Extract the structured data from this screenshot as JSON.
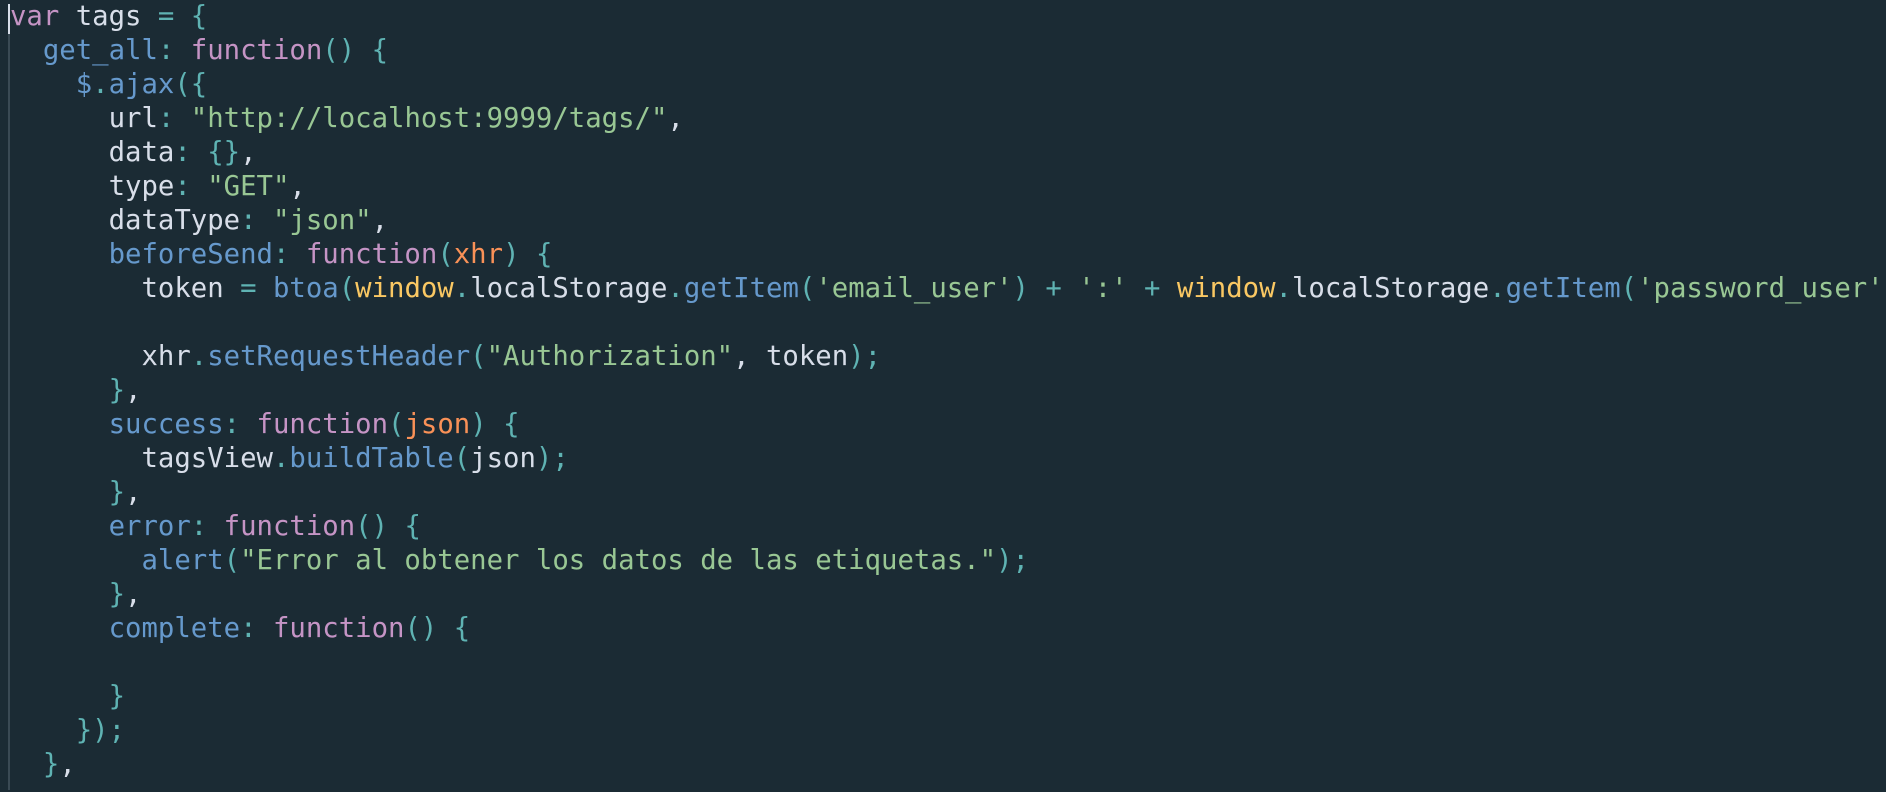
{
  "editor": {
    "language": "javascript",
    "theme_colors": {
      "background": "#1b2b34",
      "keyword": "#c594c5",
      "property": "#6699cc",
      "string": "#99c794",
      "punctuation": "#5fb3b3",
      "parameter": "#f99157",
      "global": "#fac863",
      "identifier": "#d8dee9"
    },
    "lines": [
      [
        [
          "kw",
          "var"
        ],
        [
          "id",
          " tags "
        ],
        [
          "punc",
          "="
        ],
        [
          "id",
          " "
        ],
        [
          "punc",
          "{"
        ]
      ],
      [
        [
          "id",
          "  "
        ],
        [
          "prop",
          "get_all"
        ],
        [
          "punc",
          ":"
        ],
        [
          "id",
          " "
        ],
        [
          "kw",
          "function"
        ],
        [
          "punc",
          "()"
        ],
        [
          "id",
          " "
        ],
        [
          "punc",
          "{"
        ]
      ],
      [
        [
          "id",
          "    "
        ],
        [
          "prop",
          "$"
        ],
        [
          "punc",
          "."
        ],
        [
          "prop",
          "ajax"
        ],
        [
          "punc",
          "({"
        ]
      ],
      [
        [
          "id",
          "      url"
        ],
        [
          "punc",
          ":"
        ],
        [
          "id",
          " "
        ],
        [
          "str",
          "\"http://localhost:9999/tags/\""
        ],
        [
          "id",
          ","
        ]
      ],
      [
        [
          "id",
          "      data"
        ],
        [
          "punc",
          ":"
        ],
        [
          "id",
          " "
        ],
        [
          "punc",
          "{}"
        ],
        [
          "id",
          ","
        ]
      ],
      [
        [
          "id",
          "      type"
        ],
        [
          "punc",
          ":"
        ],
        [
          "id",
          " "
        ],
        [
          "str",
          "\"GET\""
        ],
        [
          "id",
          ","
        ]
      ],
      [
        [
          "id",
          "      dataType"
        ],
        [
          "punc",
          ":"
        ],
        [
          "id",
          " "
        ],
        [
          "str",
          "\"json\""
        ],
        [
          "id",
          ","
        ]
      ],
      [
        [
          "id",
          "      "
        ],
        [
          "prop",
          "beforeSend"
        ],
        [
          "punc",
          ":"
        ],
        [
          "id",
          " "
        ],
        [
          "kw",
          "function"
        ],
        [
          "punc",
          "("
        ],
        [
          "param",
          "xhr"
        ],
        [
          "punc",
          ")"
        ],
        [
          "id",
          " "
        ],
        [
          "punc",
          "{"
        ]
      ],
      [
        [
          "id",
          "        token "
        ],
        [
          "punc",
          "="
        ],
        [
          "id",
          " "
        ],
        [
          "fn",
          "btoa"
        ],
        [
          "punc",
          "("
        ],
        [
          "glob",
          "window"
        ],
        [
          "punc",
          "."
        ],
        [
          "id",
          "localStorage"
        ],
        [
          "punc",
          "."
        ],
        [
          "fn",
          "getItem"
        ],
        [
          "punc",
          "("
        ],
        [
          "str",
          "'email_user'"
        ],
        [
          "punc",
          ")"
        ],
        [
          "id",
          " "
        ],
        [
          "punc",
          "+"
        ],
        [
          "id",
          " "
        ],
        [
          "str",
          "':'"
        ],
        [
          "id",
          " "
        ],
        [
          "punc",
          "+"
        ],
        [
          "id",
          " "
        ],
        [
          "glob",
          "window"
        ],
        [
          "punc",
          "."
        ],
        [
          "id",
          "localStorage"
        ],
        [
          "punc",
          "."
        ],
        [
          "fn",
          "getItem"
        ],
        [
          "punc",
          "("
        ],
        [
          "str",
          "'password_user'"
        ],
        [
          "punc",
          "));"
        ]
      ],
      [
        [
          "id",
          ""
        ]
      ],
      [
        [
          "id",
          "        xhr"
        ],
        [
          "punc",
          "."
        ],
        [
          "fn",
          "setRequestHeader"
        ],
        [
          "punc",
          "("
        ],
        [
          "str",
          "\"Authorization\""
        ],
        [
          "id",
          ", token"
        ],
        [
          "punc",
          ");"
        ]
      ],
      [
        [
          "id",
          "      "
        ],
        [
          "punc",
          "}"
        ],
        [
          "id",
          ","
        ]
      ],
      [
        [
          "id",
          "      "
        ],
        [
          "prop",
          "success"
        ],
        [
          "punc",
          ":"
        ],
        [
          "id",
          " "
        ],
        [
          "kw",
          "function"
        ],
        [
          "punc",
          "("
        ],
        [
          "param",
          "json"
        ],
        [
          "punc",
          ")"
        ],
        [
          "id",
          " "
        ],
        [
          "punc",
          "{"
        ]
      ],
      [
        [
          "id",
          "        tagsView"
        ],
        [
          "punc",
          "."
        ],
        [
          "fn",
          "buildTable"
        ],
        [
          "punc",
          "("
        ],
        [
          "id",
          "json"
        ],
        [
          "punc",
          ");"
        ]
      ],
      [
        [
          "id",
          "      "
        ],
        [
          "punc",
          "}"
        ],
        [
          "id",
          ","
        ]
      ],
      [
        [
          "id",
          "      "
        ],
        [
          "prop",
          "error"
        ],
        [
          "punc",
          ":"
        ],
        [
          "id",
          " "
        ],
        [
          "kw",
          "function"
        ],
        [
          "punc",
          "()"
        ],
        [
          "id",
          " "
        ],
        [
          "punc",
          "{"
        ]
      ],
      [
        [
          "id",
          "        "
        ],
        [
          "fn",
          "alert"
        ],
        [
          "punc",
          "("
        ],
        [
          "str",
          "\"Error al obtener los datos de las etiquetas.\""
        ],
        [
          "punc",
          ");"
        ]
      ],
      [
        [
          "id",
          "      "
        ],
        [
          "punc",
          "}"
        ],
        [
          "id",
          ","
        ]
      ],
      [
        [
          "id",
          "      "
        ],
        [
          "prop",
          "complete"
        ],
        [
          "punc",
          ":"
        ],
        [
          "id",
          " "
        ],
        [
          "kw",
          "function"
        ],
        [
          "punc",
          "()"
        ],
        [
          "id",
          " "
        ],
        [
          "punc",
          "{"
        ]
      ],
      [
        [
          "id",
          ""
        ]
      ],
      [
        [
          "id",
          "      "
        ],
        [
          "punc",
          "}"
        ]
      ],
      [
        [
          "id",
          "    "
        ],
        [
          "punc",
          "});"
        ]
      ],
      [
        [
          "id",
          "  "
        ],
        [
          "punc",
          "}"
        ],
        [
          "id",
          ","
        ]
      ]
    ]
  }
}
